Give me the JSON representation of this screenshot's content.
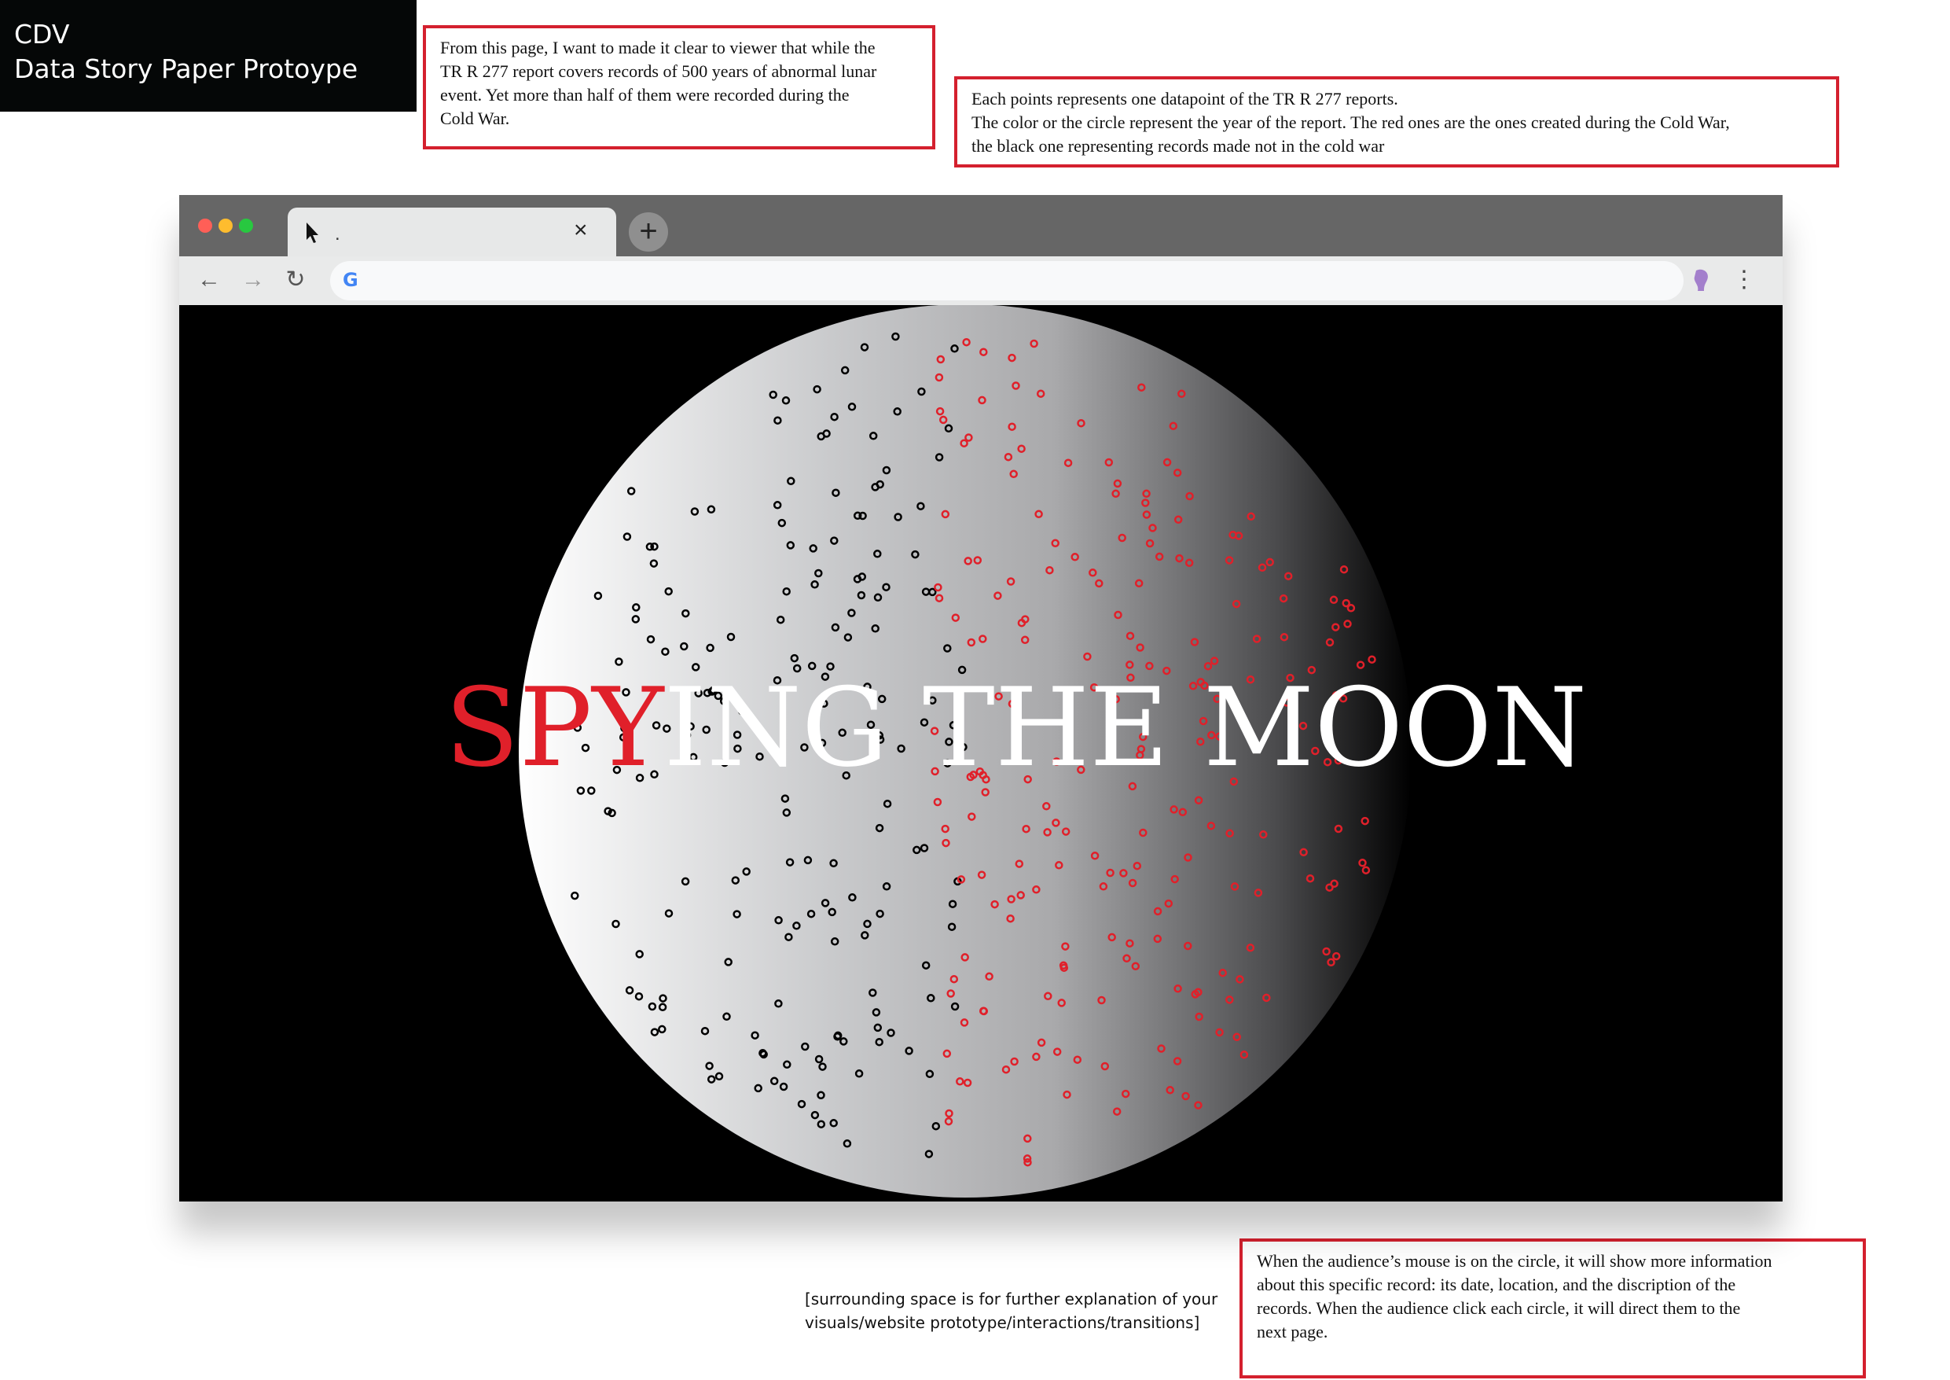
{
  "header": {
    "line1": "CDV",
    "line2": "Data Story Paper Protoype"
  },
  "notes": {
    "intro": "From this page, I want to made it clear to viewer that while the\nTR R 277 report covers records of 500 years of abnormal lunar\nevent. Yet more than half of them were recorded during the\nCold War.",
    "legend": "Each points represents one datapoint of the TR R 277 reports.\nThe color or the circle represent the year of the report. The red ones are the ones created during the Cold War,\nthe black one representing records made not in the cold war",
    "interaction": "When the audience’s mouse is on the circle, it will show more information\nabout this specific record: its date, location, and the discription of the\nrecords. When the audience click each circle, it will direct them to the\nnext page."
  },
  "caption": "[surrounding space is for further explanation of your\nvisuals/website prototype/interactions/transitions]",
  "browser": {
    "tab_title": ".",
    "tab_close": "×",
    "new_tab": "+",
    "back": "←",
    "forward": "→",
    "reload": "↻",
    "search_icon": "G",
    "menu": "⋮",
    "icons": [
      "close-window-icon",
      "minimize-window-icon",
      "maximize-window-icon",
      "cursor-icon",
      "google-icon",
      "profile-icon"
    ],
    "traffic_colors": [
      "#ff5f57",
      "#febc2e",
      "#28c840"
    ]
  },
  "page": {
    "title_highlight": "SPY",
    "title_rest": "ING THE MOON",
    "accent_color": "#e0202a",
    "point_colors": {
      "cold_war": "#e0202a",
      "not_cold_war": "#000000"
    },
    "record_counts": {
      "not_cold_war": 200,
      "cold_war": 230
    }
  }
}
